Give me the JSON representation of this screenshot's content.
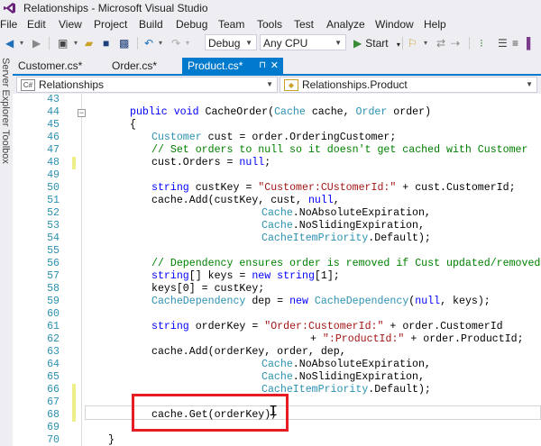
{
  "window": {
    "title": "Relationships - Microsoft Visual Studio"
  },
  "menu": [
    "File",
    "Edit",
    "View",
    "Project",
    "Build",
    "Debug",
    "Team",
    "Tools",
    "Test",
    "Analyze",
    "Window",
    "Help"
  ],
  "toolbar": {
    "configuration": "Debug",
    "platform": "Any CPU",
    "start_label": "Start",
    "start_icon": "play-icon"
  },
  "side_panels": [
    "Server Explorer",
    "Toolbox"
  ],
  "tabs": [
    {
      "label": "Customer.cs*",
      "active": false
    },
    {
      "label": "Order.cs*",
      "active": false
    },
    {
      "label": "Product.cs*",
      "active": true,
      "pin": "⊓",
      "close": "✕"
    }
  ],
  "nav": {
    "project": "Relationships",
    "class": "Relationships.Product",
    "icon": "C#"
  },
  "editor": {
    "line_numbers": [
      "43",
      "44",
      "45",
      "46",
      "47",
      "48",
      "49",
      "50",
      "51",
      "52",
      "53",
      "54",
      "55",
      "56",
      "57",
      "58",
      "59",
      "60",
      "61",
      "62",
      "63",
      "64",
      "65",
      "66",
      "67",
      "68",
      "69",
      "70"
    ],
    "collapse_symbol": "−"
  },
  "colors": {
    "accent": "#007acc",
    "highlight_box": "#e51c23"
  }
}
